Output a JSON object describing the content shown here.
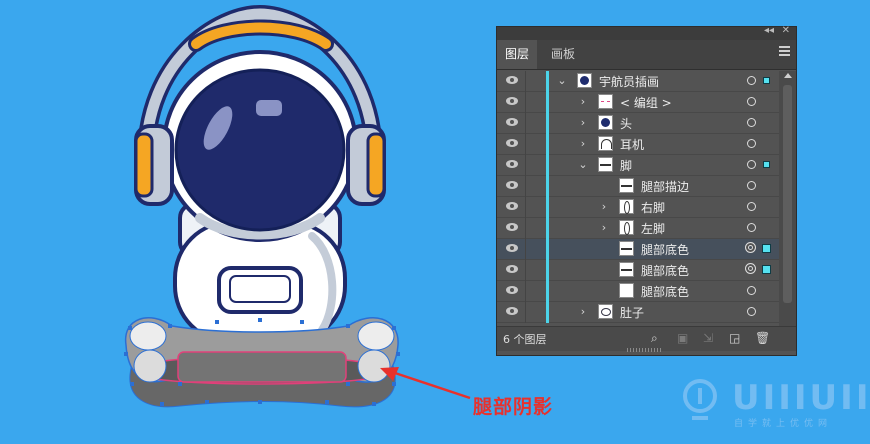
{
  "canvas": {
    "background": "#3aa7ee",
    "annotation_label": "腿部阴影",
    "annotation_color": "#e8312c"
  },
  "watermark": {
    "word": "UIIIUIII",
    "subtitle": "自学就上优优网"
  },
  "layers_panel": {
    "tabs": [
      {
        "label": "图层",
        "active": true
      },
      {
        "label": "画板",
        "active": false
      }
    ],
    "selection_color": "#55e1f0",
    "rows": [
      {
        "name": "宇航员插画",
        "expander": "open",
        "thumb": "dark",
        "target": "single",
        "selection": "small"
      },
      {
        "name": "< 编组 >",
        "expander": "closed",
        "thumb": "pink",
        "target": "single",
        "selection": "none"
      },
      {
        "name": "头",
        "expander": "closed",
        "thumb": "dark",
        "target": "single",
        "selection": "none"
      },
      {
        "name": "耳机",
        "expander": "closed",
        "thumb": "arch",
        "target": "single",
        "selection": "none"
      },
      {
        "name": "脚",
        "expander": "open",
        "thumb": "stripe",
        "target": "single",
        "selection": "small"
      },
      {
        "name": "腿部描边",
        "expander": "none",
        "thumb": "stripe",
        "target": "single",
        "selection": "none"
      },
      {
        "name": "右脚",
        "expander": "closed",
        "thumb": "oval",
        "target": "single",
        "selection": "none"
      },
      {
        "name": "左脚",
        "expander": "closed",
        "thumb": "oval",
        "target": "single",
        "selection": "none"
      },
      {
        "name": "腿部底色",
        "expander": "none",
        "thumb": "stripe",
        "target": "double",
        "selection": "big",
        "selected": true
      },
      {
        "name": "腿部底色",
        "expander": "none",
        "thumb": "stripe",
        "target": "double",
        "selection": "big"
      },
      {
        "name": "腿部底色",
        "expander": "none",
        "thumb": "plain",
        "target": "single",
        "selection": "none"
      },
      {
        "name": "肚子",
        "expander": "closed",
        "thumb": "ring",
        "target": "single",
        "selection": "none"
      }
    ],
    "footer": {
      "count": "6 个图层"
    }
  }
}
